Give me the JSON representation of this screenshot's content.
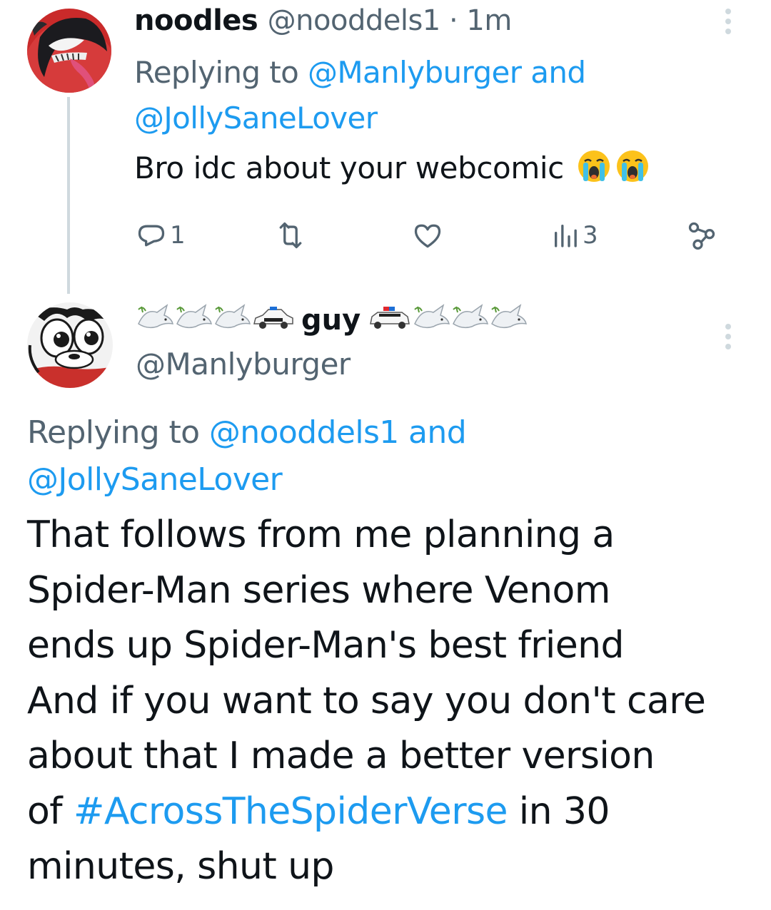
{
  "tweets": [
    {
      "display_name": "noodles",
      "handle": "@nooddels1",
      "separator": " · ",
      "time": "1m",
      "replying_prefix": "Replying to ",
      "replying_mentions": [
        "@Manlyburger",
        "@JollySaneLover"
      ],
      "replying_joiner": " and",
      "text": "Bro idc about your webcomic",
      "text_emojis": [
        "loudly-crying-face",
        "loudly-crying-face"
      ],
      "actions": {
        "reply_count": "1",
        "retweet_count": "",
        "like_count": "",
        "views_count": "3"
      },
      "avatar": "venom-avatar"
    },
    {
      "display_name": "guy",
      "display_name_emojis_before": [
        "dove-icon",
        "dove-icon",
        "dove-icon",
        "police-car-icon"
      ],
      "display_name_emojis_after": [
        "police-car-icon",
        "dove-icon",
        "dove-icon",
        "dove-icon"
      ],
      "handle": "@Manlyburger",
      "replying_prefix": "Replying to ",
      "replying_mentions": [
        "@nooddels1",
        "@JollySaneLover"
      ],
      "replying_joiner": " and",
      "text_lines": [
        "That follows from me planning a",
        "Spider-Man series where Venom",
        "ends up Spider-Man's best friend",
        "And if you want to say you don't care",
        "about that I made a better version",
        "of ",
        "#AcrossTheSpiderVerse",
        " in 30",
        "minutes, shut up"
      ],
      "avatar": "cartoon-avatar"
    }
  ],
  "colors": {
    "link": "#1d9bf0",
    "secondary_text": "#536471",
    "primary_text": "#0f1419",
    "thread_line": "#cfd9de"
  }
}
